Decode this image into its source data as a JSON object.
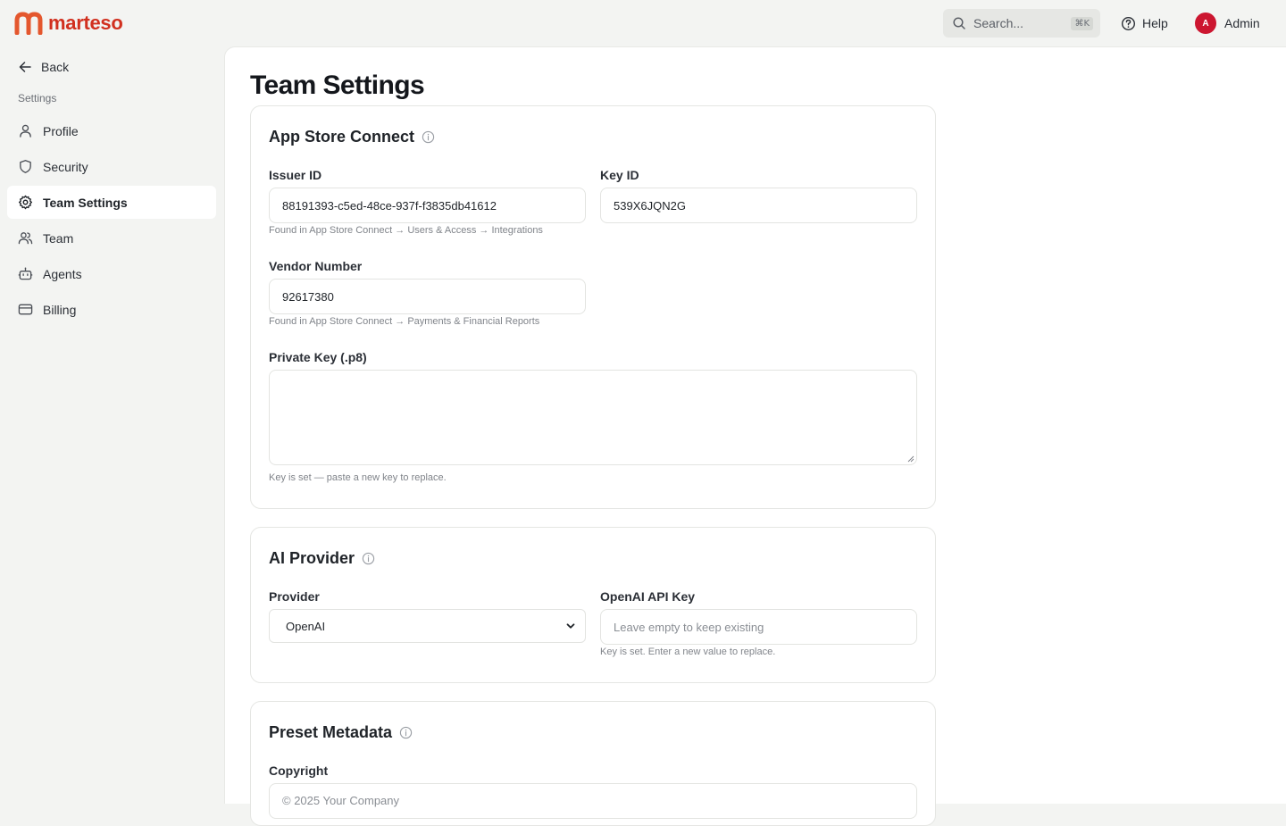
{
  "brand": {
    "name": "marteso",
    "color": "#d1301f"
  },
  "topbar": {
    "search_placeholder": "Search...",
    "search_shortcut": "⌘K",
    "help_label": "Help",
    "user_initial": "A",
    "user_name": "Admin"
  },
  "sidebar": {
    "back_label": "Back",
    "section_label": "Settings",
    "items": [
      {
        "label": "Profile",
        "icon": "user-icon"
      },
      {
        "label": "Security",
        "icon": "shield-icon"
      },
      {
        "label": "Team Settings",
        "icon": "gear-icon",
        "active": true
      },
      {
        "label": "Team",
        "icon": "users-icon"
      },
      {
        "label": "Agents",
        "icon": "bot-icon"
      },
      {
        "label": "Billing",
        "icon": "credit-card-icon"
      }
    ]
  },
  "page": {
    "title": "Team Settings"
  },
  "app_store_connect": {
    "title": "App Store Connect",
    "issuer_label": "Issuer ID",
    "issuer_value": "88191393-c5ed-48ce-937f-f3835db41612",
    "issuer_hint": "Found in App Store Connect → Users & Access → Integrations",
    "key_label": "Key ID",
    "key_value": "539X6JQN2G",
    "vendor_label": "Vendor Number",
    "vendor_value": "92617380",
    "vendor_hint": "Found in App Store Connect → Payments & Financial Reports",
    "private_key_label": "Private Key (.p8)",
    "private_key_value": "",
    "private_key_hint": "Key is set — paste a new key to replace."
  },
  "ai_provider": {
    "title": "AI Provider",
    "provider_label": "Provider",
    "provider_value": "OpenAI",
    "api_key_label": "OpenAI API Key",
    "api_key_placeholder": "Leave empty to keep existing",
    "api_key_hint": "Key is set. Enter a new value to replace."
  },
  "preset_metadata": {
    "title": "Preset Metadata",
    "copyright_label": "Copyright",
    "copyright_placeholder": "© 2025 Your Company"
  }
}
